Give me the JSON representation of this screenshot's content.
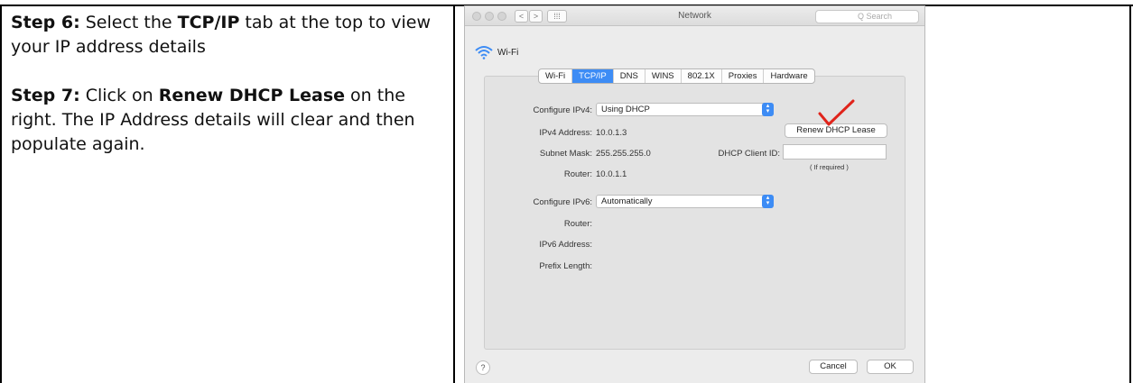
{
  "instructions": {
    "step6": {
      "prefix": "Step 6:",
      "t1": " Select the ",
      "bold": "TCP/IP",
      "t2": " tab at the top to view your IP address details"
    },
    "step7": {
      "prefix": "Step 7:",
      "t1": " Click on ",
      "bold": "Renew DHCP Lease",
      "t2": " on the right. The IP Address details will clear and then populate again."
    }
  },
  "window": {
    "title": "Network",
    "search_placeholder": "Q Search",
    "nav_back": "<",
    "nav_forward": ">",
    "nav_grid": "⁞⁞⁞"
  },
  "interface": {
    "name": "Wi-Fi"
  },
  "tabs": [
    {
      "label": "Wi-Fi",
      "active": false
    },
    {
      "label": "TCP/IP",
      "active": true
    },
    {
      "label": "DNS",
      "active": false
    },
    {
      "label": "WINS",
      "active": false
    },
    {
      "label": "802.1X",
      "active": false
    },
    {
      "label": "Proxies",
      "active": false
    },
    {
      "label": "Hardware",
      "active": false
    }
  ],
  "ipv4": {
    "configure_label": "Configure IPv4:",
    "configure_value": "Using DHCP",
    "address_label": "IPv4 Address:",
    "address_value": "10.0.1.3",
    "subnet_label": "Subnet Mask:",
    "subnet_value": "255.255.255.0",
    "router_label": "Router:",
    "router_value": "10.0.1.1",
    "renew_button": "Renew DHCP Lease",
    "client_id_label": "DHCP Client ID:",
    "client_id_value": "",
    "client_id_hint": "( If required )"
  },
  "ipv6": {
    "configure_label": "Configure IPv6:",
    "configure_value": "Automatically",
    "router_label": "Router:",
    "address_label": "IPv6 Address:",
    "prefix_label": "Prefix Length:"
  },
  "footer": {
    "help": "?",
    "cancel": "Cancel",
    "ok": "OK"
  },
  "colors": {
    "accent": "#3d8cf5",
    "annotation": "#e0241b"
  }
}
